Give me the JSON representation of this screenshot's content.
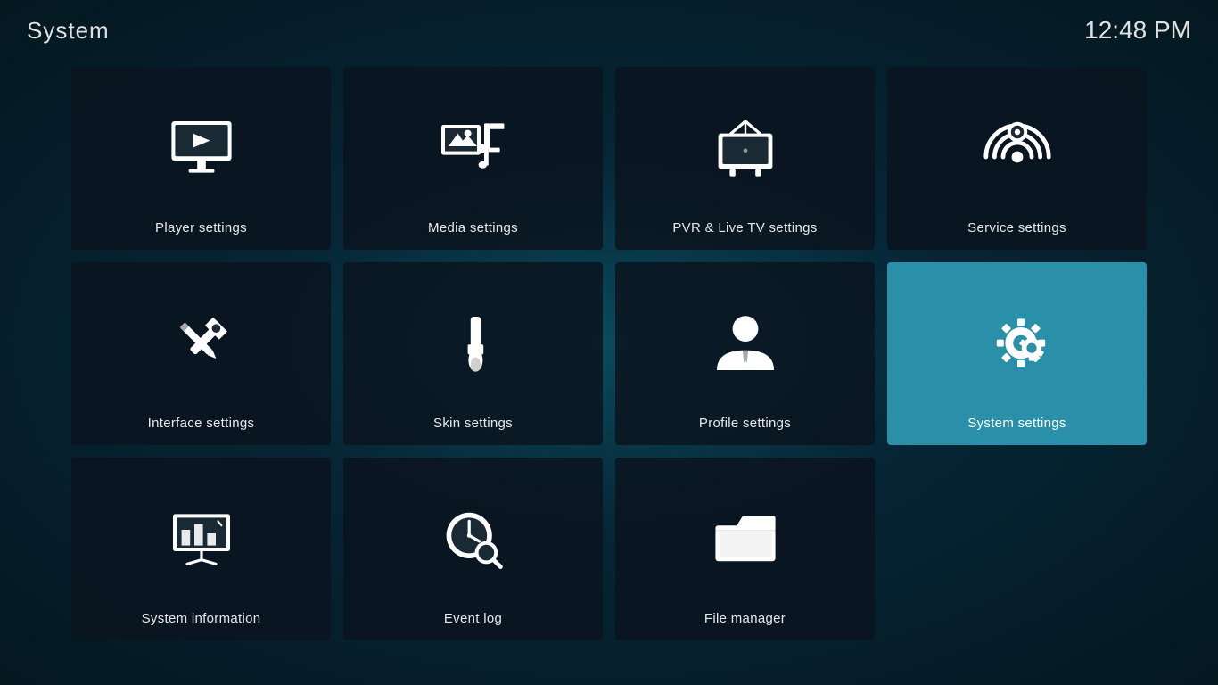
{
  "header": {
    "title": "System",
    "time": "12:48 PM"
  },
  "grid": {
    "items": [
      {
        "id": "player-settings",
        "label": "Player settings",
        "icon": "player",
        "active": false
      },
      {
        "id": "media-settings",
        "label": "Media settings",
        "icon": "media",
        "active": false
      },
      {
        "id": "pvr-settings",
        "label": "PVR & Live TV settings",
        "icon": "pvr",
        "active": false
      },
      {
        "id": "service-settings",
        "label": "Service settings",
        "icon": "service",
        "active": false
      },
      {
        "id": "interface-settings",
        "label": "Interface settings",
        "icon": "interface",
        "active": false
      },
      {
        "id": "skin-settings",
        "label": "Skin settings",
        "icon": "skin",
        "active": false
      },
      {
        "id": "profile-settings",
        "label": "Profile settings",
        "icon": "profile",
        "active": false
      },
      {
        "id": "system-settings",
        "label": "System settings",
        "icon": "system",
        "active": true
      },
      {
        "id": "system-information",
        "label": "System information",
        "icon": "sysinfo",
        "active": false
      },
      {
        "id": "event-log",
        "label": "Event log",
        "icon": "eventlog",
        "active": false
      },
      {
        "id": "file-manager",
        "label": "File manager",
        "icon": "filemanager",
        "active": false
      },
      {
        "id": "empty",
        "label": "",
        "icon": "empty",
        "active": false
      }
    ]
  }
}
